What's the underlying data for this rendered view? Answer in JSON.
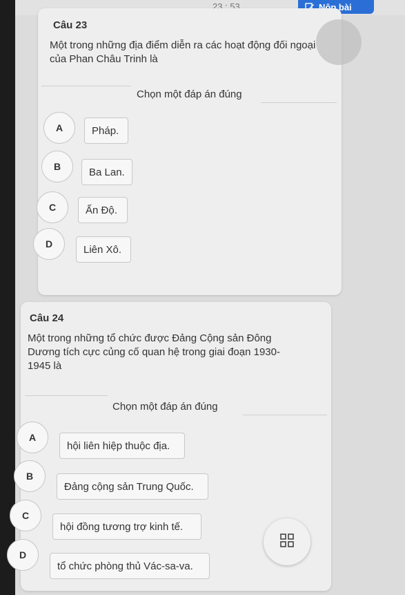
{
  "header": {
    "timer": "23 : 53",
    "submit_label": "Nộp bài"
  },
  "questions": [
    {
      "title": "Câu 23",
      "text_lines": [
        "Một trong những địa điểm diễn ra các hoạt động đối ngoại",
        "của Phan Châu Trinh là"
      ],
      "instruction": "Chọn một đáp án đúng",
      "options": [
        {
          "letter": "A",
          "text": "Pháp."
        },
        {
          "letter": "B",
          "text": "Ba Lan."
        },
        {
          "letter": "C",
          "text": "Ấn Độ."
        },
        {
          "letter": "D",
          "text": "Liên Xô."
        }
      ]
    },
    {
      "title": "Câu 24",
      "text_lines": [
        "Một trong những tổ chức được Đảng Cộng sản Đông",
        "Dương tích cực củng cố quan hệ trong giai đoạn 1930-",
        "1945 là"
      ],
      "instruction": "Chọn một đáp án đúng",
      "options": [
        {
          "letter": "A",
          "text": "hội liên hiệp thuộc địa."
        },
        {
          "letter": "B",
          "text": "Đảng cộng sản Trung Quốc."
        },
        {
          "letter": "C",
          "text": "hội đồng tương trợ kinh tế."
        },
        {
          "letter": "D",
          "text": "tổ chức phòng thủ Vác-sa-va."
        }
      ]
    }
  ],
  "icons": {
    "submit": "edit-icon",
    "navigator": "grid-icon"
  },
  "colors": {
    "accent": "#2b6fd6",
    "background": "#dcdcdc",
    "card": "#eeeeee"
  }
}
